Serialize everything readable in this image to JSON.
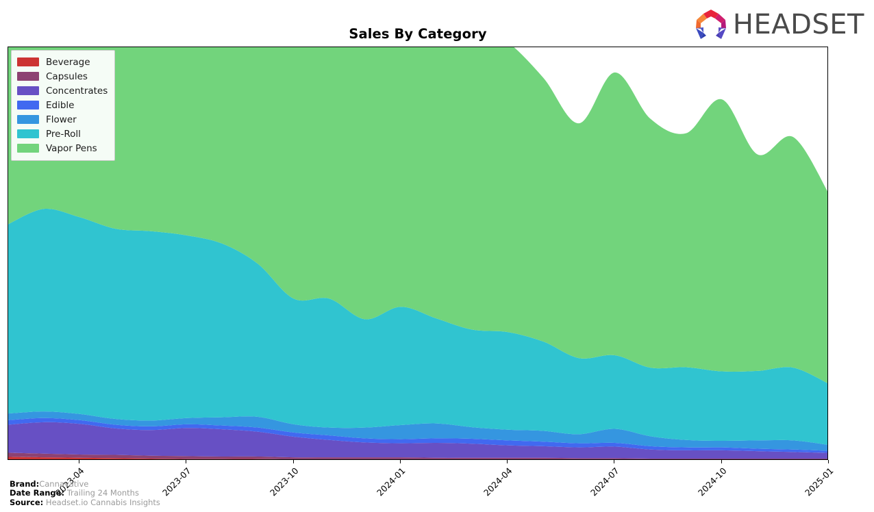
{
  "header": {
    "title": "Sales By Category",
    "logo_text": "HEADSET",
    "logo_icon": "headset-logo-icon"
  },
  "footer": {
    "brand_key": "Brand:",
    "brand_value": "Cannavative",
    "date_range_key": "Date Range:",
    "date_range_value": "Trailing 24 Months",
    "source_key": "Source:",
    "source_value": "Headset.io Cannabis Insights"
  },
  "legend": {
    "position": "upper-left",
    "items": [
      {
        "label": "Beverage",
        "color": "#cc3333"
      },
      {
        "label": "Capsules",
        "color": "#8d4272"
      },
      {
        "label": "Concentrates",
        "color": "#6750c4"
      },
      {
        "label": "Edible",
        "color": "#4169f0"
      },
      {
        "label": "Flower",
        "color": "#3596e0"
      },
      {
        "label": "Pre-Roll",
        "color": "#30c4d0"
      },
      {
        "label": "Vapor Pens",
        "color": "#72d47c"
      }
    ]
  },
  "chart_data": {
    "type": "area",
    "title": "Sales By Category",
    "subtype": "stacked-area",
    "xlabel": "",
    "ylabel": "",
    "grid": false,
    "legend_position": "upper left",
    "axis_tick_labels": [
      "2023-04",
      "2023-07",
      "2023-10",
      "2024-01",
      "2024-04",
      "2024-07",
      "2024-10",
      "2025-01"
    ],
    "x": [
      "2023-02",
      "2023-03",
      "2023-04",
      "2023-05",
      "2023-06",
      "2023-07",
      "2023-08",
      "2023-09",
      "2023-10",
      "2023-11",
      "2023-12",
      "2024-01",
      "2024-02",
      "2024-03",
      "2024-04",
      "2024-05",
      "2024-06",
      "2024-07",
      "2024-08",
      "2024-09",
      "2024-10",
      "2024-11",
      "2024-12",
      "2025-01"
    ],
    "xlim": [
      "2023-02",
      "2025-01"
    ],
    "ylim": [
      0,
      100
    ],
    "yunit": "percent-of-plot-height",
    "series": [
      {
        "name": "Beverage",
        "color": "#cc3333",
        "values": [
          0.9,
          0.8,
          0.7,
          0.6,
          0.5,
          0.4,
          0.4,
          0.4,
          0.3,
          0.3,
          0.3,
          0.3,
          0.3,
          0.3,
          0.3,
          0.3,
          0.2,
          0.2,
          0.2,
          0.2,
          0.2,
          0.2,
          0.2,
          0.2
        ]
      },
      {
        "name": "Capsules",
        "color": "#8d4272",
        "values": [
          1.0,
          0.9,
          0.8,
          0.8,
          0.7,
          0.7,
          0.6,
          0.6,
          0.5,
          0.5,
          0.5,
          0.5,
          0.4,
          0.4,
          0.4,
          0.4,
          0.4,
          0.4,
          0.3,
          0.3,
          0.3,
          0.3,
          0.3,
          0.3
        ]
      },
      {
        "name": "Concentrates",
        "color": "#6750c4",
        "values": [
          6.8,
          7.6,
          7.4,
          6.4,
          6.2,
          6.8,
          6.6,
          6.0,
          5.0,
          4.2,
          3.6,
          3.4,
          3.6,
          3.4,
          3.0,
          2.8,
          2.6,
          2.8,
          2.2,
          2.0,
          2.0,
          1.8,
          1.6,
          1.4
        ]
      },
      {
        "name": "Edible",
        "color": "#4169f0",
        "values": [
          1.1,
          1.0,
          0.9,
          0.9,
          0.9,
          0.9,
          0.9,
          1.0,
          1.0,
          1.1,
          1.0,
          1.0,
          1.1,
          1.2,
          1.2,
          1.1,
          1.0,
          0.9,
          0.8,
          0.7,
          0.7,
          0.6,
          0.6,
          0.5
        ]
      },
      {
        "name": "Flower",
        "color": "#3596e0",
        "values": [
          1.6,
          1.6,
          1.5,
          1.4,
          1.4,
          1.5,
          2.0,
          2.6,
          2.0,
          1.9,
          2.6,
          3.4,
          3.6,
          2.8,
          2.6,
          2.6,
          2.2,
          3.4,
          2.4,
          1.8,
          1.6,
          2.0,
          2.2,
          1.4
        ]
      },
      {
        "name": "Pre-Roll",
        "color": "#30c4d0",
        "values": [
          45.8,
          49.0,
          47.6,
          46.0,
          45.8,
          44.2,
          42.0,
          37.0,
          30.4,
          31.2,
          26.2,
          28.6,
          25.4,
          23.6,
          23.6,
          21.6,
          18.4,
          17.8,
          16.6,
          17.6,
          16.8,
          16.8,
          17.6,
          14.8
        ]
      },
      {
        "name": "Vapor Pens",
        "color": "#72d47c",
        "values": [
          87.2,
          78.2,
          74.6,
          77.2,
          80.6,
          83.0,
          85.0,
          88.8,
          76.6,
          81.0,
          73.0,
          84.2,
          80.0,
          74.6,
          70.2,
          63.8,
          56.8,
          68.4,
          60.2,
          56.6,
          65.8,
          52.4,
          55.8,
          46.0
        ]
      }
    ]
  }
}
